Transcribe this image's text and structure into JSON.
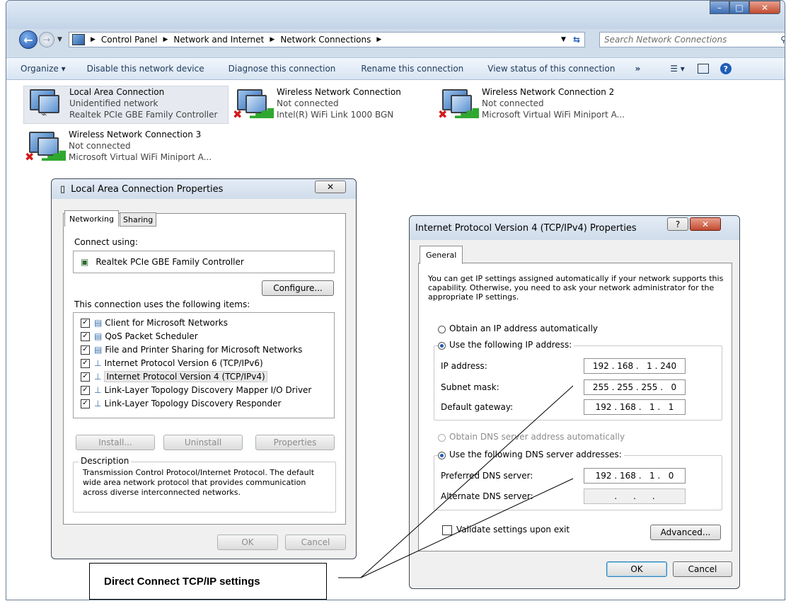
{
  "window": {
    "caption": {
      "minimize": "–",
      "maximize": "□",
      "close": "✕"
    },
    "breadcrumbs": [
      "Control Panel",
      "Network and Internet",
      "Network Connections"
    ],
    "search_placeholder": "Search Network Connections"
  },
  "toolbar": {
    "organize": "Organize ▾",
    "disable": "Disable this network device",
    "diagnose": "Diagnose this connection",
    "rename": "Rename this connection",
    "view_status": "View status of this connection",
    "more": "»"
  },
  "connections": [
    {
      "name": "Local Area Connection",
      "status": "Unidentified network",
      "device": "Realtek PCIe GBE Family Controller"
    },
    {
      "name": "Wireless Network Connection",
      "status": "Not connected",
      "device": "Intel(R) WiFi Link 1000 BGN"
    },
    {
      "name": "Wireless Network Connection 2",
      "status": "Not connected",
      "device": "Microsoft Virtual WiFi Miniport A..."
    },
    {
      "name": "Wireless Network Connection 3",
      "status": "Not connected",
      "device": "Microsoft Virtual WiFi Miniport A..."
    }
  ],
  "lac_dialog": {
    "title": "Local Area Connection Properties",
    "close": "✕",
    "tabs": [
      "Networking",
      "Sharing"
    ],
    "connect_using_label": "Connect using:",
    "adapter": "Realtek PCIe GBE Family Controller",
    "configure": "Configure...",
    "items_label": "This connection uses the following items:",
    "items": [
      {
        "label": "Client for Microsoft Networks",
        "checked": true
      },
      {
        "label": "QoS Packet Scheduler",
        "checked": true
      },
      {
        "label": "File and Printer Sharing for Microsoft Networks",
        "checked": true
      },
      {
        "label": "Internet Protocol Version 6 (TCP/IPv6)",
        "checked": true
      },
      {
        "label": "Internet Protocol Version 4 (TCP/IPv4)",
        "checked": true
      },
      {
        "label": "Link-Layer Topology Discovery Mapper I/O Driver",
        "checked": true
      },
      {
        "label": "Link-Layer Topology Discovery Responder",
        "checked": true
      }
    ],
    "install": "Install...",
    "uninstall": "Uninstall",
    "properties": "Properties",
    "description_label": "Description",
    "description": "Transmission Control Protocol/Internet Protocol. The default wide area network protocol that provides communication across diverse interconnected networks.",
    "ok": "OK",
    "cancel": "Cancel"
  },
  "ipv4_dialog": {
    "title": "Internet Protocol Version 4 (TCP/IPv4) Properties",
    "help": "?",
    "close": "✕",
    "tab": "General",
    "intro": "You can get IP settings assigned automatically if your network supports this capability. Otherwise, you need to ask your network administrator for the appropriate IP settings.",
    "obtain_ip": "Obtain an IP address automatically",
    "use_ip": "Use the following IP address:",
    "ip_label": "IP address:",
    "ip_value": "192 . 168 .   1 . 240",
    "mask_label": "Subnet mask:",
    "mask_value": "255 . 255 . 255 .   0",
    "gw_label": "Default gateway:",
    "gw_value": "192 . 168 .   1 .   1",
    "obtain_dns": "Obtain DNS server address automatically",
    "use_dns": "Use the following DNS server addresses:",
    "pref_dns_label": "Preferred DNS server:",
    "pref_dns_value": "192 . 168 .   1 .   0",
    "alt_dns_label": "Alternate DNS server:",
    "alt_dns_value": ".      .      .",
    "validate": "Validate settings upon exit",
    "advanced": "Advanced...",
    "ok": "OK",
    "cancel": "Cancel"
  },
  "callout": "Direct Connect TCP/IP settings"
}
